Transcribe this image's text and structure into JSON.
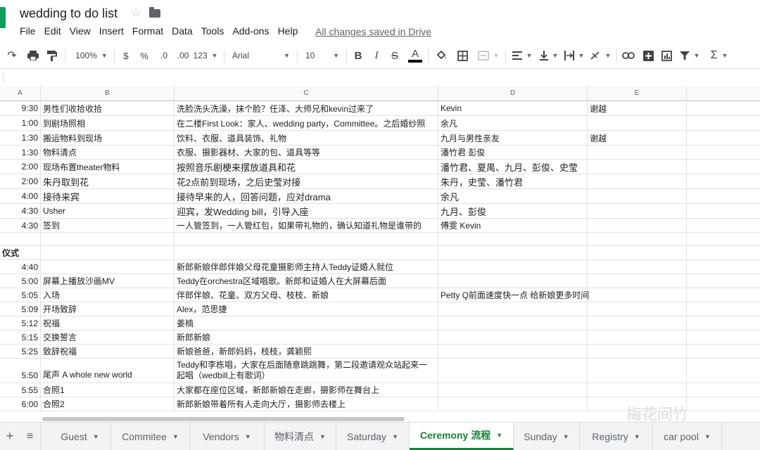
{
  "title": "wedding to do list",
  "menu": [
    "File",
    "Edit",
    "View",
    "Insert",
    "Format",
    "Data",
    "Tools",
    "Add-ons",
    "Help"
  ],
  "saved_status": "All changes saved in Drive",
  "toolbar": {
    "zoom": "100%",
    "currency": "$",
    "percent": "%",
    "dec_decrease": ".0",
    "dec_increase": ".00",
    "more_formats": "123",
    "font": "Arial",
    "font_size": "10",
    "bold": "B",
    "italic": "I",
    "strike": "S",
    "text_color": "A",
    "function": "Σ"
  },
  "columns": [
    "A",
    "B",
    "C",
    "D",
    "E"
  ],
  "rows": [
    {
      "a": "9:30",
      "b": "男性们收拾收拾",
      "c": "洗脸洗头洗澡，抹个脸？任泽、大师兄和kevin过来了",
      "d": "Kevin",
      "e": "谢越"
    },
    {
      "a": "1:00",
      "b": "到剧场照相",
      "c": "在二楼First Look：家人、wedding party，Committee。之后婚纱照",
      "d": "余凡",
      "e": ""
    },
    {
      "a": "1:30",
      "b": "搬运物料到现场",
      "c": "饮料、衣服、道具装饰、礼物",
      "d": "九月与男性亲友",
      "e": "谢越"
    },
    {
      "a": "1:30",
      "b": "物料清点",
      "c": "衣服、摄影器材、大家的包、道具等等",
      "d": "潘竹君 彭俊",
      "e": ""
    },
    {
      "a": "2:00",
      "b": "现场布置theater物料",
      "c": "按照音乐剧梗来摆放道具和花",
      "d": "潘竹君、夏禺、九月、彭俊、史莹",
      "e": ""
    },
    {
      "a": "2:00",
      "b": "朱丹取到花",
      "c": "花2点前到现场，之后史莹对接",
      "d": "朱丹，史莹、潘竹君",
      "e": ""
    },
    {
      "a": "4:00",
      "b": "接待来宾",
      "c": "接待早来的人，回答问题，应对drama",
      "d": "余凡",
      "e": ""
    },
    {
      "a": "4:30",
      "b": "Usher",
      "c": "迎宾，发Wedding bill，引导入座",
      "d": "九月、彭俊",
      "e": ""
    },
    {
      "a": "4:30",
      "b": "签到",
      "c": "一人管签到，一人管红包，如果带礼物的，确认知道礼物是谁带的",
      "d": "傅雯 Kevin",
      "e": ""
    },
    {
      "a": "",
      "b": "",
      "c": "",
      "d": "",
      "e": ""
    },
    {
      "a": "仪式",
      "b": "",
      "c": "",
      "d": "",
      "e": ""
    },
    {
      "a": "4:40",
      "b": "",
      "c": "新郎新娘伴郎伴娘父母花童摄影师主持人Teddy证婚人就位",
      "d": "",
      "e": ""
    },
    {
      "a": "5:00",
      "b": "屏幕上播放沙画MV",
      "c": "Teddy在orchestra区域唱歌。新郎和证婚人在大屏幕后面",
      "d": "",
      "e": ""
    },
    {
      "a": "5:05",
      "b": "入场",
      "c": "伴郎伴娘、花童、双方父母、枝枝、新娘",
      "d": "Petty Q前面速度快一点 给新娘更多时间",
      "e": ""
    },
    {
      "a": "5:09",
      "b": "开场致辞",
      "c": "Alex，范思捷",
      "d": "",
      "e": ""
    },
    {
      "a": "5:12",
      "b": "祝福",
      "c": "姜楠",
      "d": "",
      "e": ""
    },
    {
      "a": "5:15",
      "b": "交换誓言",
      "c": "新郎新娘",
      "d": "",
      "e": ""
    },
    {
      "a": "5:25",
      "b": "致辞祝福",
      "c": "新娘爸爸，新郎妈妈，枝枝，龚颖熙",
      "d": "",
      "e": ""
    },
    {
      "a": "5:50",
      "b": "尾声 A whole new world",
      "c": "Teddy和李栋唱，大家在后面随意跳跳舞，第二段邀请观众站起来一起唱（wedbill上有歌词）",
      "d": "",
      "e": ""
    },
    {
      "a": "5:55",
      "b": "合照1",
      "c": "大家都在座位区域，新郎新娘在走廊，摄影师在舞台上",
      "d": "",
      "e": ""
    },
    {
      "a": "6:00",
      "b": "合照2",
      "c": "新郎新娘带着所有人走向大厅，摄影师去楼上",
      "d": "",
      "e": ""
    }
  ],
  "sheet_tabs": [
    "Guest",
    "Commitee",
    "Vendors",
    "物料清点",
    "Saturday",
    "Ceremony 流程",
    "Sunday",
    "Registry",
    "car pool"
  ],
  "active_tab": "Ceremony 流程",
  "watermark": "梅花间竹",
  "colors": {
    "accent": "#188038",
    "app_green": "#0f9d58"
  }
}
